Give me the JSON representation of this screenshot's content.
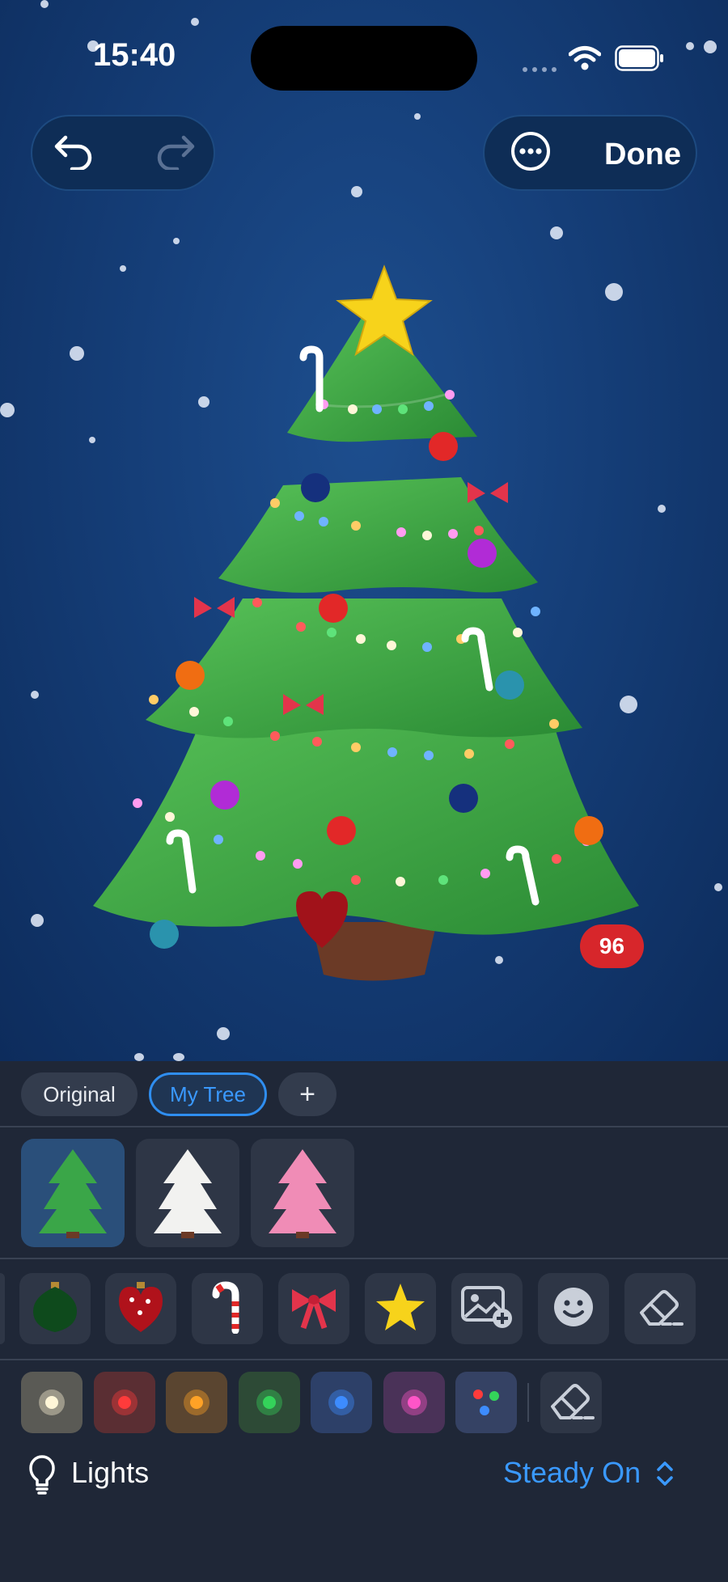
{
  "status_bar": {
    "time": "15:40"
  },
  "toolbar": {
    "done_label": "Done"
  },
  "tree": {
    "ornament_count": "96"
  },
  "tabs": [
    {
      "label": "Original",
      "active": false
    },
    {
      "label": "My Tree",
      "active": true
    },
    {
      "label": "+",
      "active": false
    }
  ],
  "tree_styles": [
    {
      "name": "green-tree",
      "color": "#3aa648",
      "selected": true
    },
    {
      "name": "white-tree",
      "color": "#f2f2f0",
      "selected": false
    },
    {
      "name": "pink-tree",
      "color": "#f08cb6",
      "selected": false
    }
  ],
  "ornaments": [
    "green-bauble-icon",
    "red-heart-bauble-icon",
    "candy-cane-icon",
    "bow-icon",
    "star-icon",
    "add-photo-icon",
    "emoji-icon",
    "eraser-icon"
  ],
  "light_colors": [
    "#fff6d8",
    "#ff3b3b",
    "#ffa226",
    "#34d35a",
    "#3d8cff",
    "#ff55c8",
    "multicolor"
  ],
  "lights": {
    "label": "Lights",
    "mode": "Steady On"
  }
}
